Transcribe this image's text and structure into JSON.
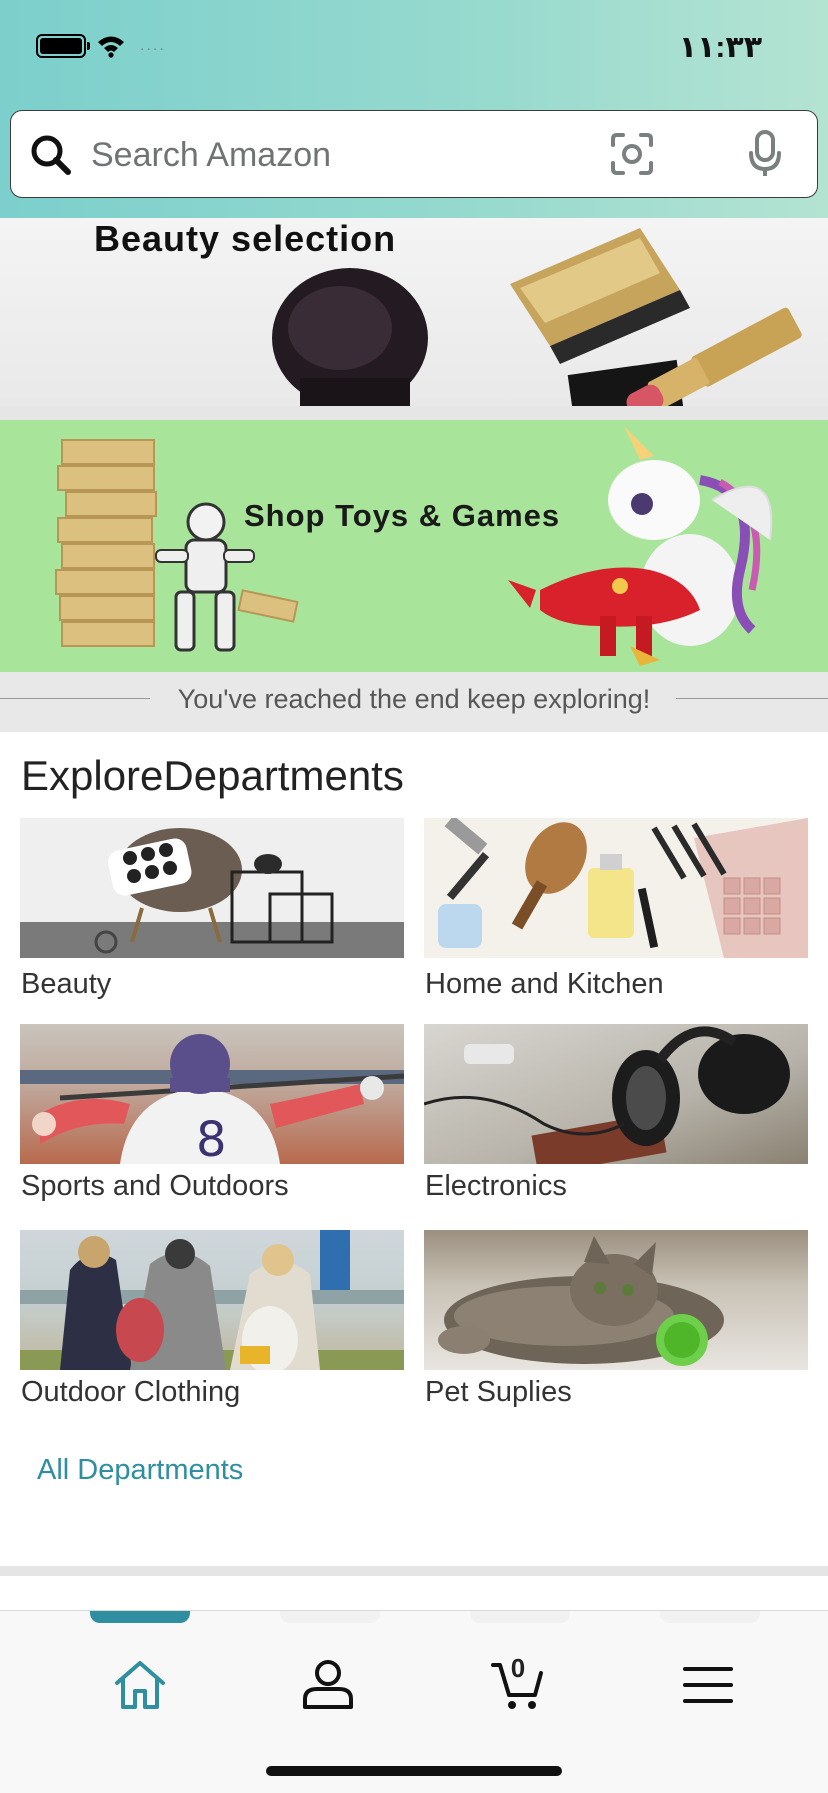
{
  "status_bar": {
    "time": "١١:٣٣",
    "signal": "...."
  },
  "search": {
    "placeholder": "Search Amazon",
    "value": ""
  },
  "banners": {
    "beauty": {
      "title": "Beauty selection"
    },
    "toys": {
      "title": "Shop Toys & Games"
    }
  },
  "end_message": "You've reached the end keep exploring!",
  "departments": {
    "title": "ExploreDepartments",
    "items": [
      {
        "label": "Beauty"
      },
      {
        "label": "Home and Kitchen"
      },
      {
        "label": "Sports and Outdoors"
      },
      {
        "label": "Electronics"
      },
      {
        "label": "Outdoor Clothing"
      },
      {
        "label": "Pet Suplies"
      }
    ],
    "all_link": "All Departments"
  },
  "tabbar": {
    "cart_count": "0",
    "active_tab": "home",
    "accent_color": "#2f8fa0",
    "icons": [
      "home-icon",
      "profile-icon",
      "cart-icon",
      "menu-icon"
    ]
  },
  "colors": {
    "link": "#2f8fa0",
    "toys_banner_bg": "#a8e59a",
    "header_gradient_start": "#7ccfcc"
  }
}
